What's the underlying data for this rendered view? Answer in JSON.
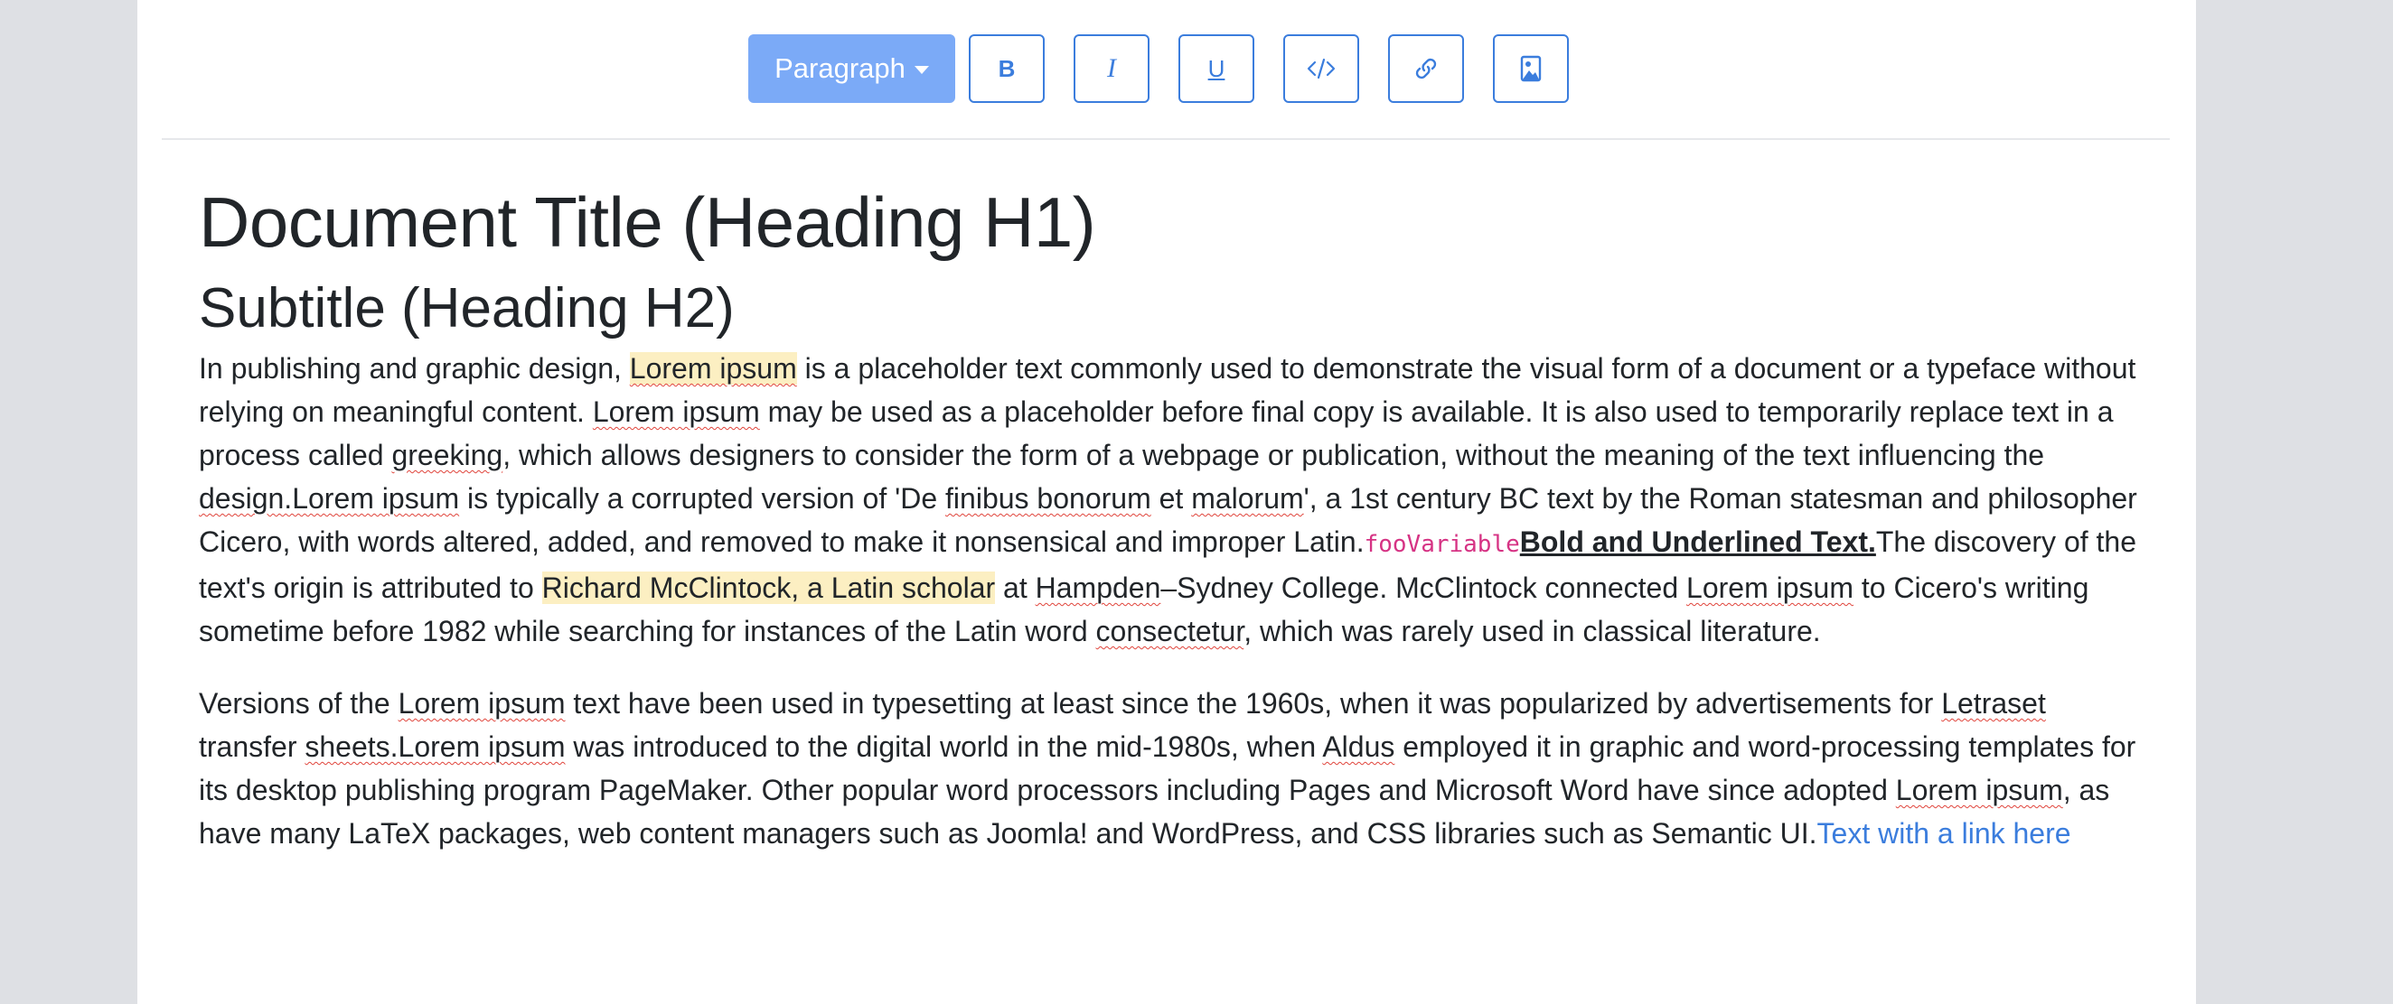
{
  "toolbar": {
    "paragraph_label": "Paragraph",
    "bold_label": "B",
    "italic_label": "I",
    "underline_label": "U",
    "buttons": [
      "format-dropdown",
      "bold",
      "italic",
      "underline",
      "code",
      "link",
      "image"
    ]
  },
  "document": {
    "h1": "Document Title (Heading H1)",
    "h2": "Subtitle (Heading H2)",
    "p1": {
      "t0": "In publishing and graphic design, ",
      "hl1": "Lorem ipsum",
      "t1": " is a placeholder text commonly used to demonstrate the visual form of a document or a typeface without relying on meaningful content. ",
      "s1": "Lorem ipsum",
      "t2": " may be used as a placeholder before final copy is available. It is also used to temporarily replace text in a process called ",
      "s2": "greeking",
      "t3": ", which allows designers to consider the form of a webpage or publication, without the meaning of the text influencing the ",
      "s3": "design.Lorem ipsum",
      "t4": " is typically a corrupted version of 'De ",
      "s4": "finibus bonorum",
      "t5": " et ",
      "s5": "malorum",
      "t6": "', a 1st century BC text by the Roman statesman and philosopher Cicero, with words altered, added, and removed to make it nonsensical and improper Latin.",
      "code": "fooVariable",
      "bold_underlined": "Bold and Underlined Text.",
      "t7": "The discovery of the text's origin is attributed to ",
      "hl2": "Richard McClintock, a Latin scholar",
      "t8": " at ",
      "s6": "Hampden",
      "t9": "–Sydney College. McClintock connected ",
      "s7": "Lorem ipsum",
      "t10": " to Cicero's writing sometime before 1982 while searching for instances of the Latin word ",
      "s8": "consectetur",
      "t11": ", which was rarely used in classical literature."
    },
    "p2": {
      "t0": "Versions of the ",
      "s1": "Lorem ipsum",
      "t1": " text have been used in typesetting at least since the 1960s, when it was popularized by advertisements for ",
      "s2": "Letraset",
      "t2": " transfer ",
      "s3": "sheets.Lorem ipsum",
      "t3": " was introduced to the digital world in the mid-1980s, when ",
      "s4": "Aldus",
      "t4": " employed it in graphic and word-processing templates for its desktop publishing program PageMaker. Other popular word processors including Pages and Microsoft Word have since adopted ",
      "s5": "Lorem ipsum",
      "t5": ", as have many LaTeX packages, web content managers such as Joomla! and WordPress, and CSS libraries such as Semantic UI.",
      "link": "Text with a link here"
    }
  },
  "colors": {
    "accent": "#3b7ddd",
    "dropdown_bg": "#7baaf7",
    "highlight": "#fcefc2",
    "code": "#d63384",
    "spellcheck": "#e0443b"
  }
}
